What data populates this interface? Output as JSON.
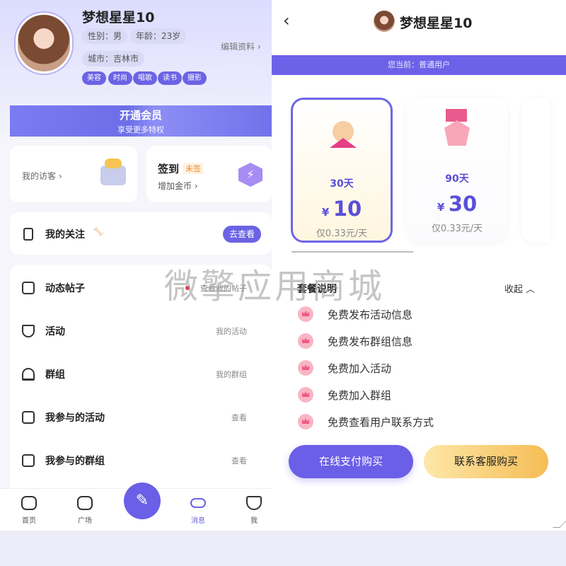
{
  "left": {
    "profile": {
      "name": "梦想星星10",
      "gender": "性别：男",
      "age": "年龄：23岁",
      "city": "城市：吉林市",
      "edit": "编辑资料",
      "tags": [
        "美容",
        "时尚",
        "唱歌",
        "读书",
        "摄影"
      ]
    },
    "vip": {
      "title": "开通会员",
      "subtitle": "享受更多特权"
    },
    "visitors": {
      "label": "我的访客"
    },
    "signin": {
      "title": "签到",
      "badge": "未签",
      "sub": "增加金币"
    },
    "follow": {
      "label": "我的关注",
      "button": "去查看"
    },
    "rows": [
      {
        "label": "动态帖子",
        "link": "查看我的帖子",
        "icon": "post-icon"
      },
      {
        "label": "活动",
        "link": "我的活动",
        "icon": "shield-check-icon"
      },
      {
        "label": "群组",
        "link": "我的群组",
        "icon": "group-icon"
      },
      {
        "label": "我参与的活动",
        "link": "查看",
        "icon": "image-icon"
      },
      {
        "label": "我参与的群组",
        "link": "查看",
        "icon": "joined-group-icon"
      }
    ],
    "nav": [
      {
        "label": "首页",
        "icon": "home-icon",
        "active": false
      },
      {
        "label": "广场",
        "icon": "square-icon",
        "active": false
      },
      {
        "label": "消息",
        "icon": "message-icon",
        "active": true
      },
      {
        "label": "我",
        "icon": "cat-icon",
        "active": false
      }
    ],
    "fab_icon": "edit-pen-icon"
  },
  "right": {
    "header": {
      "back_icon": "chevron-left-icon",
      "name": "梦想星星10"
    },
    "current": "您当前：普通用户",
    "plans": [
      {
        "days": "30天",
        "currency": "¥",
        "price": "10",
        "per_day": "仅0.33元/天",
        "selected": true,
        "icon": "angel-icon"
      },
      {
        "days": "90天",
        "currency": "¥",
        "price": "30",
        "per_day": "仅0.33元/天",
        "selected": false,
        "icon": "medal-icon"
      }
    ],
    "package": {
      "title": "套餐说明",
      "toggle": "收起"
    },
    "benefits": [
      "免费发布活动信息",
      "免费发布群组信息",
      "免费加入活动",
      "免费加入群组",
      "免费查看用户联系方式"
    ],
    "buttons": {
      "online": "在线支付购买",
      "service": "联系客服购买"
    }
  },
  "watermark": "微擎应用商城",
  "colors": {
    "primary": "#6b63e4",
    "gold": "#f5bd55",
    "accent_orange": "#f08a24"
  }
}
